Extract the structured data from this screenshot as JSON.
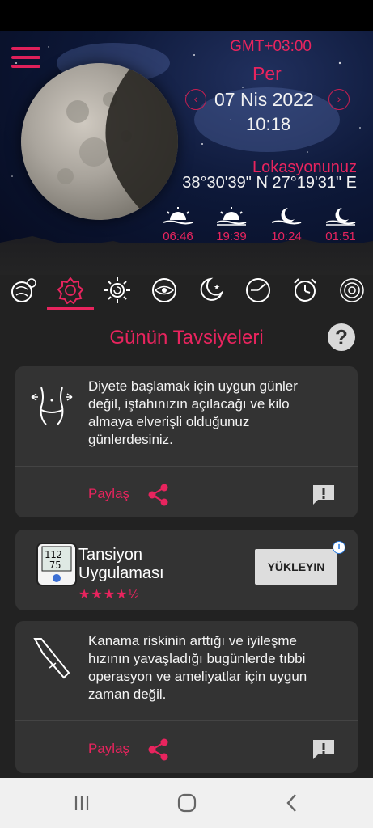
{
  "header": {
    "timezone": "GMT+03:00",
    "day": "Per",
    "date": "07 Nis 2022",
    "time": "10:18",
    "location_label": "Lokasyonunuz",
    "coordinates": "38°30'39\" N 27°19'31\" E",
    "events": [
      {
        "icon": "sunrise-icon",
        "time": "06:46"
      },
      {
        "icon": "sunset-icon",
        "time": "19:39"
      },
      {
        "icon": "moonrise-icon",
        "time": "10:24"
      },
      {
        "icon": "moonset-icon",
        "time": "01:51"
      }
    ]
  },
  "tabs": [
    "planet-signs-icon",
    "zodiac-badge-icon",
    "sun-spiral-icon",
    "eye-icon",
    "moon-stars-icon",
    "compass-icon",
    "alarm-clock-icon",
    "spiral-icon"
  ],
  "section": {
    "title": "Günün Tavsiyeleri",
    "help": "?"
  },
  "cards": [
    {
      "icon": "body-diet-icon",
      "text": "Diyete başlamak için uygun günler değil, iştahınızın açılacağı ve kilo almaya elverişli olduğunuz günlerdesiniz.",
      "share_label": "Paylaş"
    },
    {
      "icon": "scalpel-icon",
      "text": "Kanama riskinin arttığı ve iyileşme hızının yavaşladığı bugünlerde tıbbi operasyon ve ameliyatlar için uygun zaman değil.",
      "share_label": "Paylaş"
    }
  ],
  "ad": {
    "title": "Tansiyon Uygulaması",
    "rating": 4.5,
    "stars": "★★★★½",
    "cta": "YÜKLEYIN",
    "thumb_values": [
      "112",
      "75"
    ]
  },
  "colors": {
    "accent": "#e8245e",
    "background": "#242424",
    "card": "#333333"
  }
}
